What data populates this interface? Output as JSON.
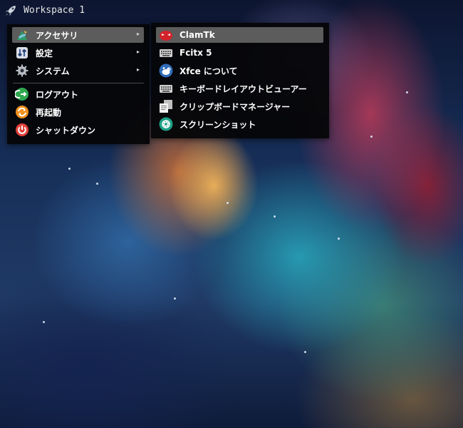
{
  "panel": {
    "workspace_label": "Workspace 1"
  },
  "main_menu": {
    "items": [
      {
        "label": "アクセサリ",
        "icon": "accessories-icon",
        "has_submenu": true,
        "active": true
      },
      {
        "label": "設定",
        "icon": "settings-icon",
        "has_submenu": true
      },
      {
        "label": "システム",
        "icon": "system-gear-icon",
        "has_submenu": true
      },
      {
        "label": "ログアウト",
        "icon": "logout-icon",
        "has_submenu": false
      },
      {
        "label": "再起動",
        "icon": "restart-icon",
        "has_submenu": false
      },
      {
        "label": "シャットダウン",
        "icon": "power-icon",
        "has_submenu": false
      }
    ],
    "submenu_arrow": "▸"
  },
  "sub_menu": {
    "items": [
      {
        "label": "ClamTk",
        "icon": "clamtk-icon",
        "active": true
      },
      {
        "label": "Fcitx 5",
        "icon": "keyboard-icon"
      },
      {
        "label": "Xfce について",
        "icon": "xfce-mouse-icon"
      },
      {
        "label": "キーボードレイアウトビューアー",
        "icon": "keyboard-layout-icon"
      },
      {
        "label": "クリップボードマネージャー",
        "icon": "clipboard-icon"
      },
      {
        "label": "スクリーンショット",
        "icon": "screenshot-icon"
      }
    ]
  },
  "colors": {
    "menu_bg": "#060608",
    "highlight": "#5c5c5c",
    "logout_green": "#2ea84f",
    "restart_orange": "#f0901e",
    "power_red": "#e2413b",
    "clamtk_red": "#d2232a",
    "screenshot_teal": "#1ea187"
  }
}
